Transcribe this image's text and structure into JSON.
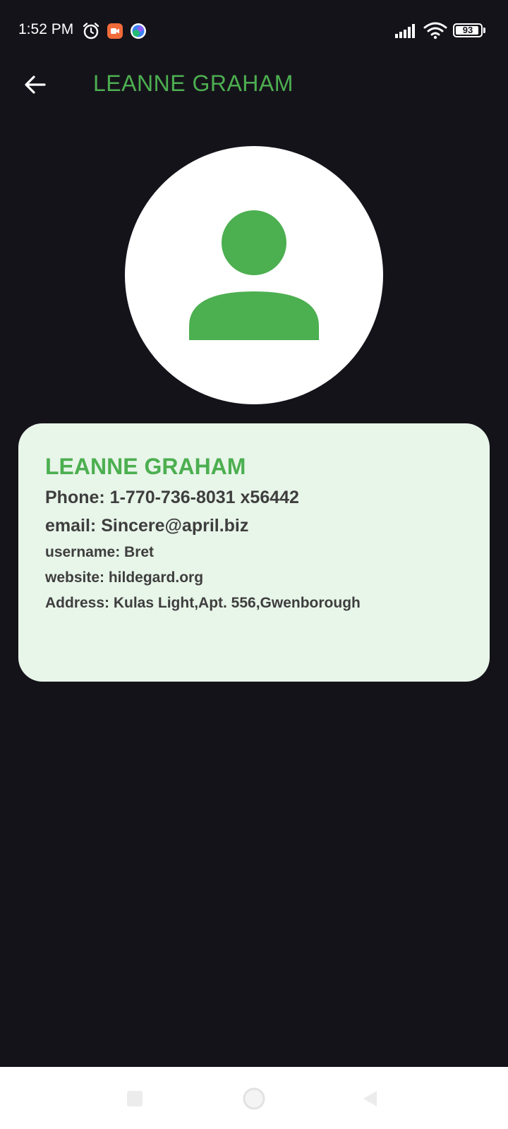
{
  "status_bar": {
    "time": "1:52 PM",
    "battery_level": "93",
    "battery_fraction": 0.93,
    "icons": [
      "alarm-icon",
      "video-app-icon",
      "browser-app-icon",
      "signal-icon",
      "wifi-icon",
      "battery-icon"
    ]
  },
  "app_bar": {
    "title": "LEANNE GRAHAM",
    "back_icon": "arrow-back-icon"
  },
  "avatar": {
    "icon": "person-icon",
    "colors": {
      "background": "#ffffff",
      "figure": "#4caf50"
    }
  },
  "card": {
    "name": "LEANNE GRAHAM",
    "phone": "Phone: 1-770-736-8031 x56442",
    "email": "email: Sincere@april.biz",
    "username": "username: Bret",
    "website": "website: hildegard.org",
    "address": "Address: Kulas Light,Apt. 556,Gwenborough"
  },
  "nav_bar": {
    "icons": [
      "recent-apps-icon",
      "home-icon",
      "back-triangle-icon"
    ]
  },
  "colors": {
    "accent": "#4caf50",
    "background": "#15131a",
    "card_background": "#e8f5e9",
    "card_text": "#3e3e3e"
  }
}
